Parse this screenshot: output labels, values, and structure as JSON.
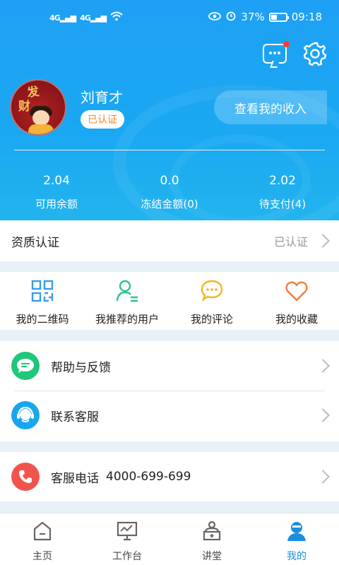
{
  "status_bar": {
    "signal1": "4G",
    "signal2": "4G",
    "battery": "37%",
    "battery_level": 0.37,
    "time": "09:18"
  },
  "header": {
    "username": "刘育才",
    "verify_label": "已认证",
    "income_button": "查看我的收入",
    "avatar_text1": "发",
    "avatar_text2": "财",
    "has_notification": true
  },
  "stats": [
    {
      "value": "2.04",
      "label": "可用余额"
    },
    {
      "value": "0.0",
      "label": "冻结金额(0)"
    },
    {
      "value": "2.02",
      "label": "待支付(4)"
    }
  ],
  "qualification": {
    "title": "资质认证",
    "status": "已认证"
  },
  "grid": [
    {
      "label": "我的二维码",
      "icon": "qrcode-icon",
      "color": "#3a9ce8"
    },
    {
      "label": "我推荐的用户",
      "icon": "user-recommend-icon",
      "color": "#2cc38a"
    },
    {
      "label": "我的评论",
      "icon": "comment-icon",
      "color": "#f5b422"
    },
    {
      "label": "我的收藏",
      "icon": "heart-icon",
      "color": "#f07b3f"
    }
  ],
  "list": [
    {
      "label": "帮助与反馈",
      "icon": "feedback-icon",
      "color": "#1ec77a"
    },
    {
      "label": "联系客服",
      "icon": "customer-service-icon",
      "color": "#1aa6ee"
    }
  ],
  "phone": {
    "label": "客服电话",
    "number": "4000-699-699",
    "icon": "phone-icon",
    "color": "#f0554d"
  },
  "nav": [
    {
      "label": "主页",
      "icon": "home-icon"
    },
    {
      "label": "工作台",
      "icon": "workbench-icon"
    },
    {
      "label": "讲堂",
      "icon": "lecture-icon"
    },
    {
      "label": "我的",
      "icon": "profile-icon",
      "active": true
    }
  ],
  "colors": {
    "header": "#1ea0f5",
    "accent": "#1a8fe0",
    "badge_text": "#f08a24"
  }
}
